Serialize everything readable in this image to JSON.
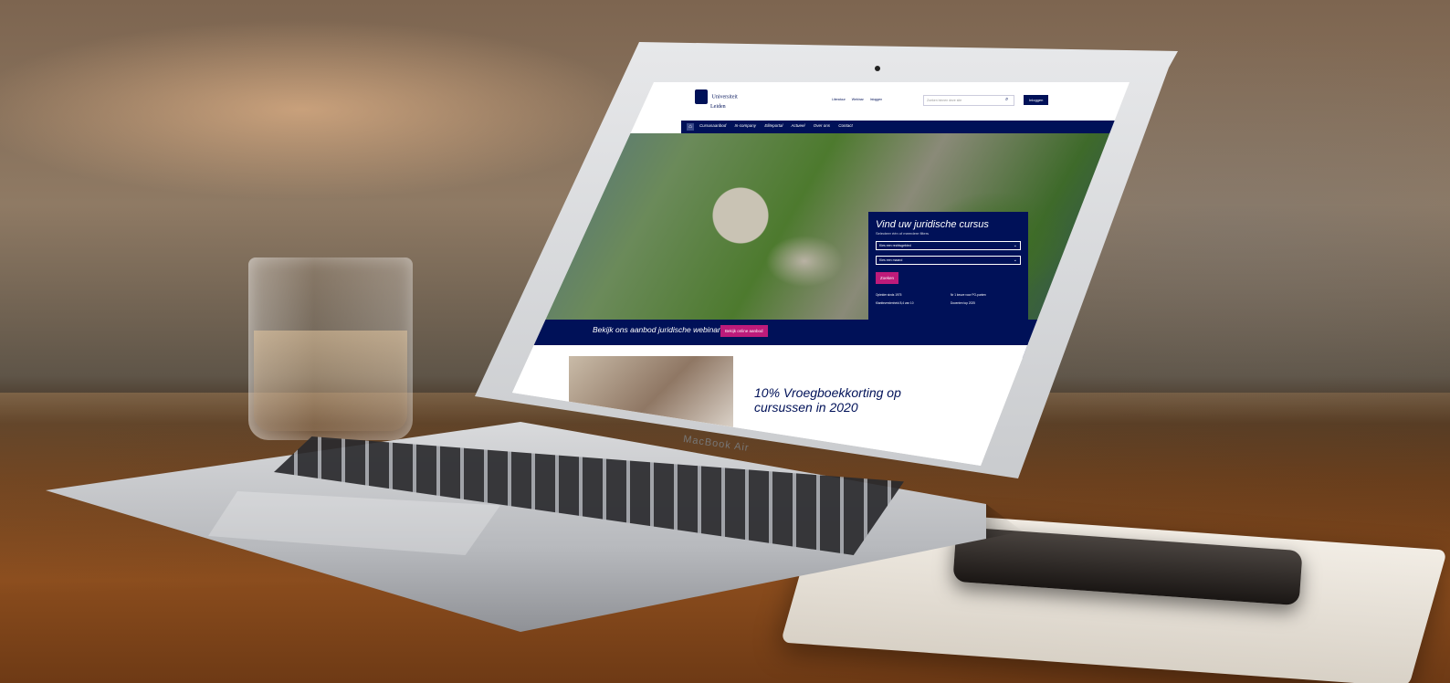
{
  "site": {
    "logo_line1": "Universiteit",
    "logo_line2": "Leiden",
    "toplinks": [
      "Literatuur",
      "Webinar",
      "Inloggen"
    ],
    "search_placeholder": "Zoeken binnen deze site",
    "login_label": "Inloggen",
    "nav": [
      "Cursusaanbod",
      "In-company",
      "Eliteportal",
      "Actueel",
      "Over ons",
      "Contact"
    ]
  },
  "panel": {
    "title": "Vind uw juridische cursus",
    "subtitle": "Selecteer één of meerdere filters",
    "select1": "Kies een rechtsgebied",
    "select2": "Kies een maand",
    "search_button": "Zoeken",
    "facts": [
      "Opleider sinds 1975",
      "Nr 1 keuze voor PO-punten",
      "Klanttevredenheid 8,4 van 10",
      "Docenten top 2025"
    ]
  },
  "webinar_bar": {
    "text": "Bekijk ons aanbod juridische webinars",
    "cta": "Bekijk online aanbod"
  },
  "promo": {
    "headline": "10% Vroegboekkorting op cursussen in 2020"
  },
  "laptop": {
    "brand": "MacBook Air"
  },
  "colors": {
    "navy": "#001158",
    "magenta": "#be1b7a"
  }
}
